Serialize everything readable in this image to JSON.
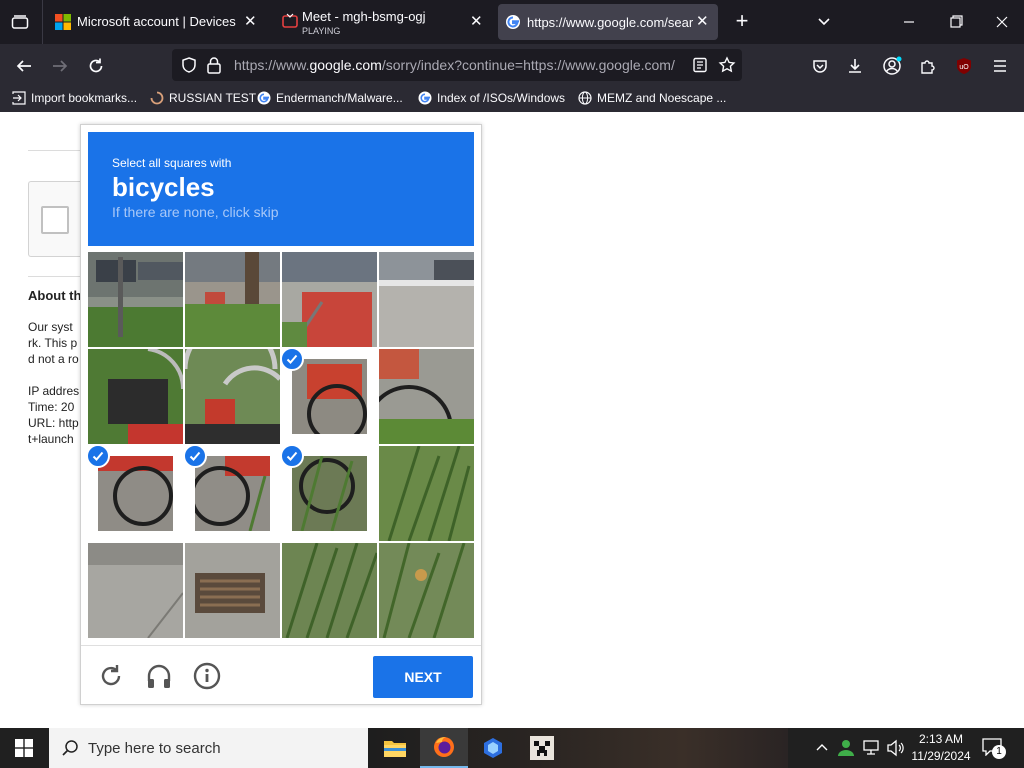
{
  "browser": {
    "tabs": [
      {
        "title": "Microsoft account | Devices",
        "subtitle": ""
      },
      {
        "title": "Meet - mgh-bsmg-ogj",
        "subtitle": "PLAYING"
      },
      {
        "title": "https://www.google.com/searc",
        "subtitle": ""
      }
    ],
    "url": {
      "prefix": "https://www.",
      "domain": "google.com",
      "suffix": "/sorry/index?continue=https://www.google.com/"
    },
    "bookmarks": [
      {
        "label": "Import bookmarks...",
        "icon": "import-icon"
      },
      {
        "label": "RUSSIAN TEST",
        "icon": "spinner-icon"
      },
      {
        "label": "Endermanch/Malware...",
        "icon": "google-icon"
      },
      {
        "label": "Index of /ISOs/Windows",
        "icon": "google-icon"
      },
      {
        "label": "MEMZ and Noescape ...",
        "icon": "globe-icon"
      }
    ]
  },
  "page": {
    "heading": "About th",
    "lines": [
      "Our syst",
      "rk. This p",
      "d not a ro",
      "IP addres",
      "Time: 20",
      "URL: http",
      "t+launch"
    ]
  },
  "captcha": {
    "instruction": "Select all squares with",
    "target": "bicycles",
    "hint": "If there are none, click skip",
    "selected_tiles": [
      6,
      8,
      9,
      10
    ],
    "next_label": "NEXT",
    "accent": "#1a73e8"
  },
  "taskbar": {
    "search_placeholder": "Type here to search",
    "time": "2:13 AM",
    "date": "11/29/2024",
    "notification_count": "1"
  }
}
